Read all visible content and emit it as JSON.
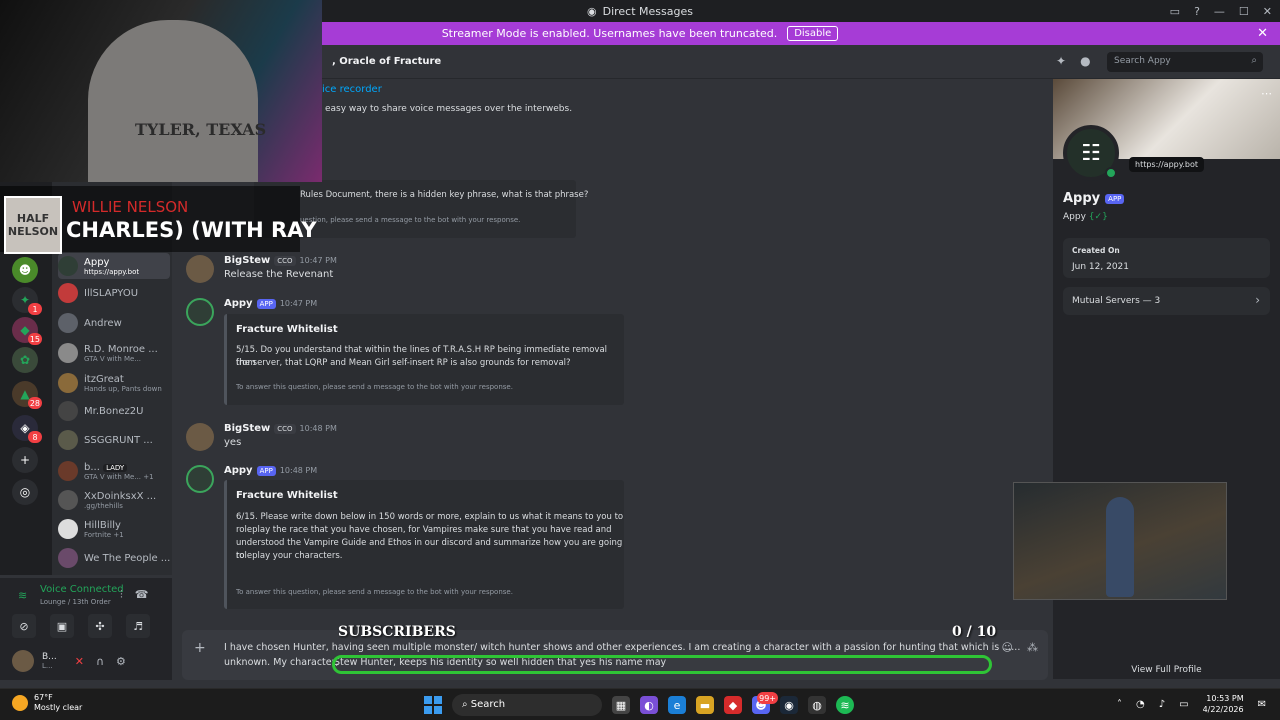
{
  "titlebar": {
    "title": "Direct Messages"
  },
  "banner": {
    "text": "Streamer Mode is enabled. Usernames have been truncated.",
    "disable_label": "Disable"
  },
  "header": {
    "channel": ", Oracle of Fracture",
    "search_placeholder": "Search Appy"
  },
  "rail_badges": [
    "1",
    "15",
    "28",
    "8"
  ],
  "dms": [
    {
      "name": "Appy",
      "sub": "https://appy.bot"
    },
    {
      "name": "IllSLAPYOU",
      "sub": ""
    },
    {
      "name": "Andrew",
      "sub": ""
    },
    {
      "name": "R.D. Monroe ...",
      "sub": "GTA V with Me..."
    },
    {
      "name": "itzGreat",
      "sub": "Hands up, Pants down"
    },
    {
      "name": "Mr.Bonez2U",
      "sub": ""
    },
    {
      "name": "SSGGRUNT ...",
      "sub": ""
    },
    {
      "name": "b...",
      "tag": "LADY",
      "sub": "GTA V with Me... +1"
    },
    {
      "name": "XxDoinksxX ...",
      "sub": ".gg/thehills"
    },
    {
      "name": "HillBilly",
      "sub": "Fortnite +1"
    },
    {
      "name": "We The People ...",
      "sub": ""
    }
  ],
  "fragments": {
    "recorder": "ice recorder",
    "recorder_desc": "easy way to share voice messages over the interwebs.",
    "rules_q": "Rules Document, there is a hidden key phrase, what is that phrase?",
    "rules_foot": "uestion, please send a message to the bot with your response."
  },
  "messages": [
    {
      "user": "BigStew",
      "tag": "CCO",
      "time": "10:47 PM",
      "text": "Release the Revenant"
    },
    {
      "user": "Appy",
      "tag": "APP",
      "time": "10:47 PM",
      "embed": {
        "title": "Fracture Whitelist",
        "lines": [
          "5/15. Do you understand that within the lines of T.R.A.S.H RP being immediate removal from",
          "the server, that LQRP and Mean Girl self-insert RP is also grounds for removal?"
        ],
        "footer": "To answer this question, please send a message to the bot with your response."
      }
    },
    {
      "user": "BigStew",
      "tag": "CCO",
      "time": "10:48 PM",
      "text": "yes"
    },
    {
      "user": "Appy",
      "tag": "APP",
      "time": "10:48 PM",
      "embed": {
        "title": "Fracture Whitelist",
        "lines": [
          "6/15. Please write down below in 150 words or more, explain to us what it means to you to",
          "roleplay the race that you have chosen, for Vampires make sure that you have read and",
          "understood the Vampire Guide and Ethos in our discord and summarize how you are going to",
          "roleplay your characters."
        ],
        "footer": "To answer this question, please send a message to the bot with your response."
      }
    }
  ],
  "composer": {
    "line1": "I have chosen Hunter, having seen multiple monster/ witch hunter shows and other experiences. I am creating a character with a passion for hunting that which is ......",
    "line2a": "unknown. My character,",
    "line2b": "Stew Hunter, keeps his identity so well hidden that yes his name may"
  },
  "overlay": {
    "subscribers": "SUBSCRIBERS",
    "count": "0 / 10"
  },
  "voice": {
    "status": "Voice Connected",
    "channel": "Lounge / 13th Order"
  },
  "user": {
    "name": "B...",
    "sub": "L..."
  },
  "profile": {
    "url": "https://appy.bot",
    "name": "Appy",
    "app_tag": "APP",
    "username": "Appy",
    "username_tag": "{✓}",
    "created_label": "Created On",
    "created_value": "Jun 12, 2021",
    "mutual": "Mutual Servers — 3",
    "view_full": "View Full Profile"
  },
  "stream_overlay": {
    "artist": "WILLIE NELSON",
    "song": "CHARLES) (WITH RAY",
    "cover_text": "HALF NELSON",
    "shirt": "TYLER, TEXAS"
  },
  "taskbar": {
    "temp": "67°F",
    "condition": "Mostly clear",
    "search": "Search",
    "time": "10:53 PM",
    "date": "4/22/2026",
    "badge": "99+"
  }
}
